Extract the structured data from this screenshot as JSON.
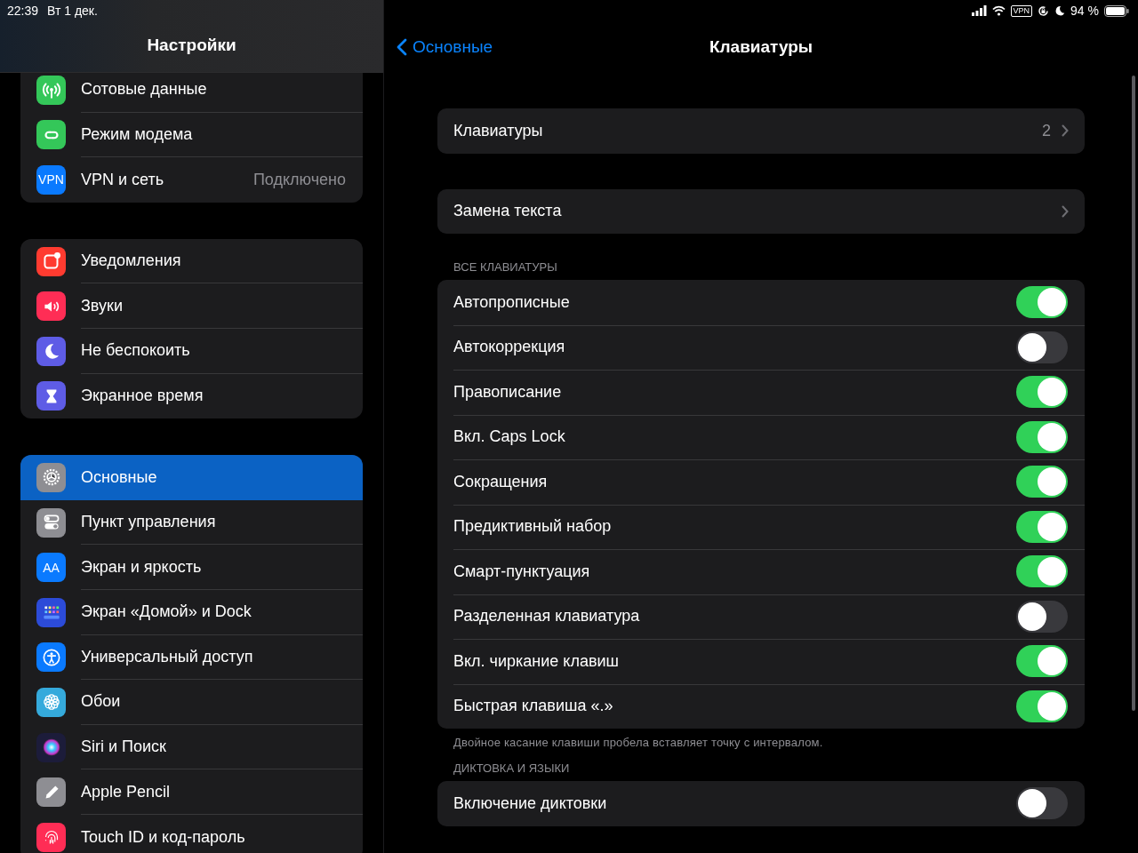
{
  "status_bar": {
    "time": "22:39",
    "date": "Вт 1 дек.",
    "vpn": "VPN",
    "battery": "94 %"
  },
  "sidebar": {
    "title": "Настройки",
    "groups": [
      {
        "items": [
          {
            "label": "Сотовые данные",
            "kind": "cellular",
            "color": "#34c759",
            "selected": false
          },
          {
            "label": "Режим модема",
            "kind": "hotspot",
            "color": "#34c759",
            "selected": false
          },
          {
            "label": "VPN и сеть",
            "value": "Подключено",
            "kind": "vpn",
            "icon_text": "VPN",
            "color": "#0a7aff",
            "selected": false
          }
        ]
      },
      {
        "items": [
          {
            "label": "Уведомления",
            "kind": "notifications",
            "color": "#ff3b30",
            "selected": false
          },
          {
            "label": "Звуки",
            "kind": "sounds",
            "color": "#ff2d55",
            "selected": false
          },
          {
            "label": "Не беспокоить",
            "kind": "dnd",
            "color": "#5e5ce6",
            "selected": false
          },
          {
            "label": "Экранное время",
            "kind": "screentime",
            "color": "#5e5ce6",
            "selected": false
          }
        ]
      },
      {
        "items": [
          {
            "label": "Основные",
            "kind": "general",
            "color": "#8e8e93",
            "selected": true
          },
          {
            "label": "Пункт управления",
            "kind": "control",
            "color": "#8e8e93",
            "selected": false
          },
          {
            "label": "Экран и яркость",
            "kind": "display",
            "icon_text": "AA",
            "color": "#0a7aff",
            "selected": false
          },
          {
            "label": "Экран «Домой» и Dock",
            "kind": "home",
            "color": "#2c4bd8",
            "selected": false
          },
          {
            "label": "Универсальный доступ",
            "kind": "accessibility",
            "color": "#0a7aff",
            "selected": false
          },
          {
            "label": "Обои",
            "kind": "wallpaper",
            "color": "#35aadc",
            "selected": false
          },
          {
            "label": "Siri и Поиск",
            "kind": "siri",
            "color": "#1c1c3a",
            "selected": false
          },
          {
            "label": "Apple Pencil",
            "kind": "pencil",
            "color": "#8e8e93",
            "selected": false
          },
          {
            "label": "Touch ID и код-пароль",
            "kind": "touchid",
            "color": "#ff2d55",
            "selected": false
          }
        ]
      }
    ]
  },
  "detail": {
    "back": "Основные",
    "title": "Клавиатуры",
    "sections": [
      {
        "rows": [
          {
            "kind": "link",
            "label": "Клавиатуры",
            "value": "2"
          }
        ]
      },
      {
        "rows": [
          {
            "kind": "link",
            "label": "Замена текста"
          }
        ]
      },
      {
        "header": "ВСЕ КЛАВИАТУРЫ",
        "footer": "Двойное касание клавиши пробела вставляет точку с интервалом.",
        "rows": [
          {
            "kind": "toggle",
            "label": "Автопрописные",
            "on": true
          },
          {
            "kind": "toggle",
            "label": "Автокоррекция",
            "on": false
          },
          {
            "kind": "toggle",
            "label": "Правописание",
            "on": true
          },
          {
            "kind": "toggle",
            "label": "Вкл. Caps Lock",
            "on": true
          },
          {
            "kind": "toggle",
            "label": "Сокращения",
            "on": true
          },
          {
            "kind": "toggle",
            "label": "Предиктивный набор",
            "on": true
          },
          {
            "kind": "toggle",
            "label": "Смарт-пунктуация",
            "on": true
          },
          {
            "kind": "toggle",
            "label": "Разделенная клавиатура",
            "on": false
          },
          {
            "kind": "toggle",
            "label": "Вкл. чиркание клавиш",
            "on": true
          },
          {
            "kind": "toggle",
            "label": "Быстрая клавиша «.»",
            "on": true
          }
        ]
      },
      {
        "header": "ДИКТОВКА И ЯЗЫКИ",
        "rows": [
          {
            "kind": "toggle",
            "label": "Включение диктовки",
            "on": false
          }
        ]
      }
    ]
  }
}
